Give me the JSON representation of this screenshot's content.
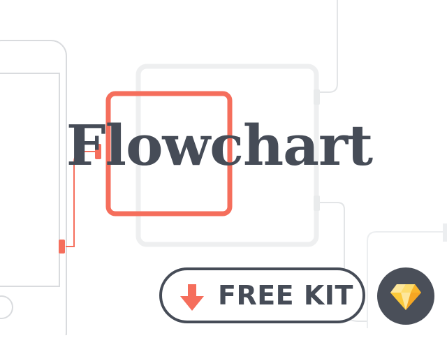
{
  "hero": {
    "title": "Flowchart"
  },
  "cta": {
    "label": "FREE KIT",
    "icon": "download-arrow-icon"
  },
  "badge": {
    "icon": "sketch-diamond-icon"
  },
  "colors": {
    "accent": "#f56e5c",
    "text": "#464c57",
    "wire": "#d6d8db",
    "ghost": "#eeeff0",
    "badge_bg": "#4a4f59",
    "gem_light": "#fde79c",
    "gem_mid": "#fbc93a",
    "gem_dark": "#f5a623"
  }
}
